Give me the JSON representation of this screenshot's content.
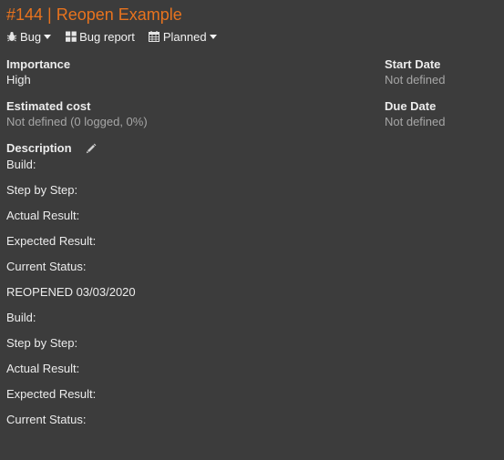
{
  "issue": {
    "title": "#144 | Reopen Example"
  },
  "toolbar": {
    "tracker_label": "Bug",
    "tracker_icon": "bug-icon",
    "category_label": "Bug report",
    "category_icon": "grid-icon",
    "status_label": "Planned",
    "status_icon": "calendar-icon"
  },
  "fields": {
    "importance": {
      "label": "Importance",
      "value": "High"
    },
    "estimated_cost": {
      "label": "Estimated cost",
      "value": "Not defined (0 logged, 0%)"
    },
    "start_date": {
      "label": "Start Date",
      "value": "Not defined"
    },
    "due_date": {
      "label": "Due Date",
      "value": "Not defined"
    }
  },
  "description": {
    "label": "Description",
    "edit_icon": "pencil-icon",
    "lines": [
      "Build:",
      "Step by Step:",
      "Actual Result:",
      "Expected Result:",
      "Current Status:",
      "REOPENED 03/03/2020",
      "Build:",
      "Step by Step:",
      "Actual Result:",
      "Expected Result:",
      "Current Status:"
    ]
  },
  "colors": {
    "background": "#3c3c3c",
    "title_accent": "#e8731e",
    "text": "#ececec",
    "muted_text": "#a6a6a6"
  }
}
